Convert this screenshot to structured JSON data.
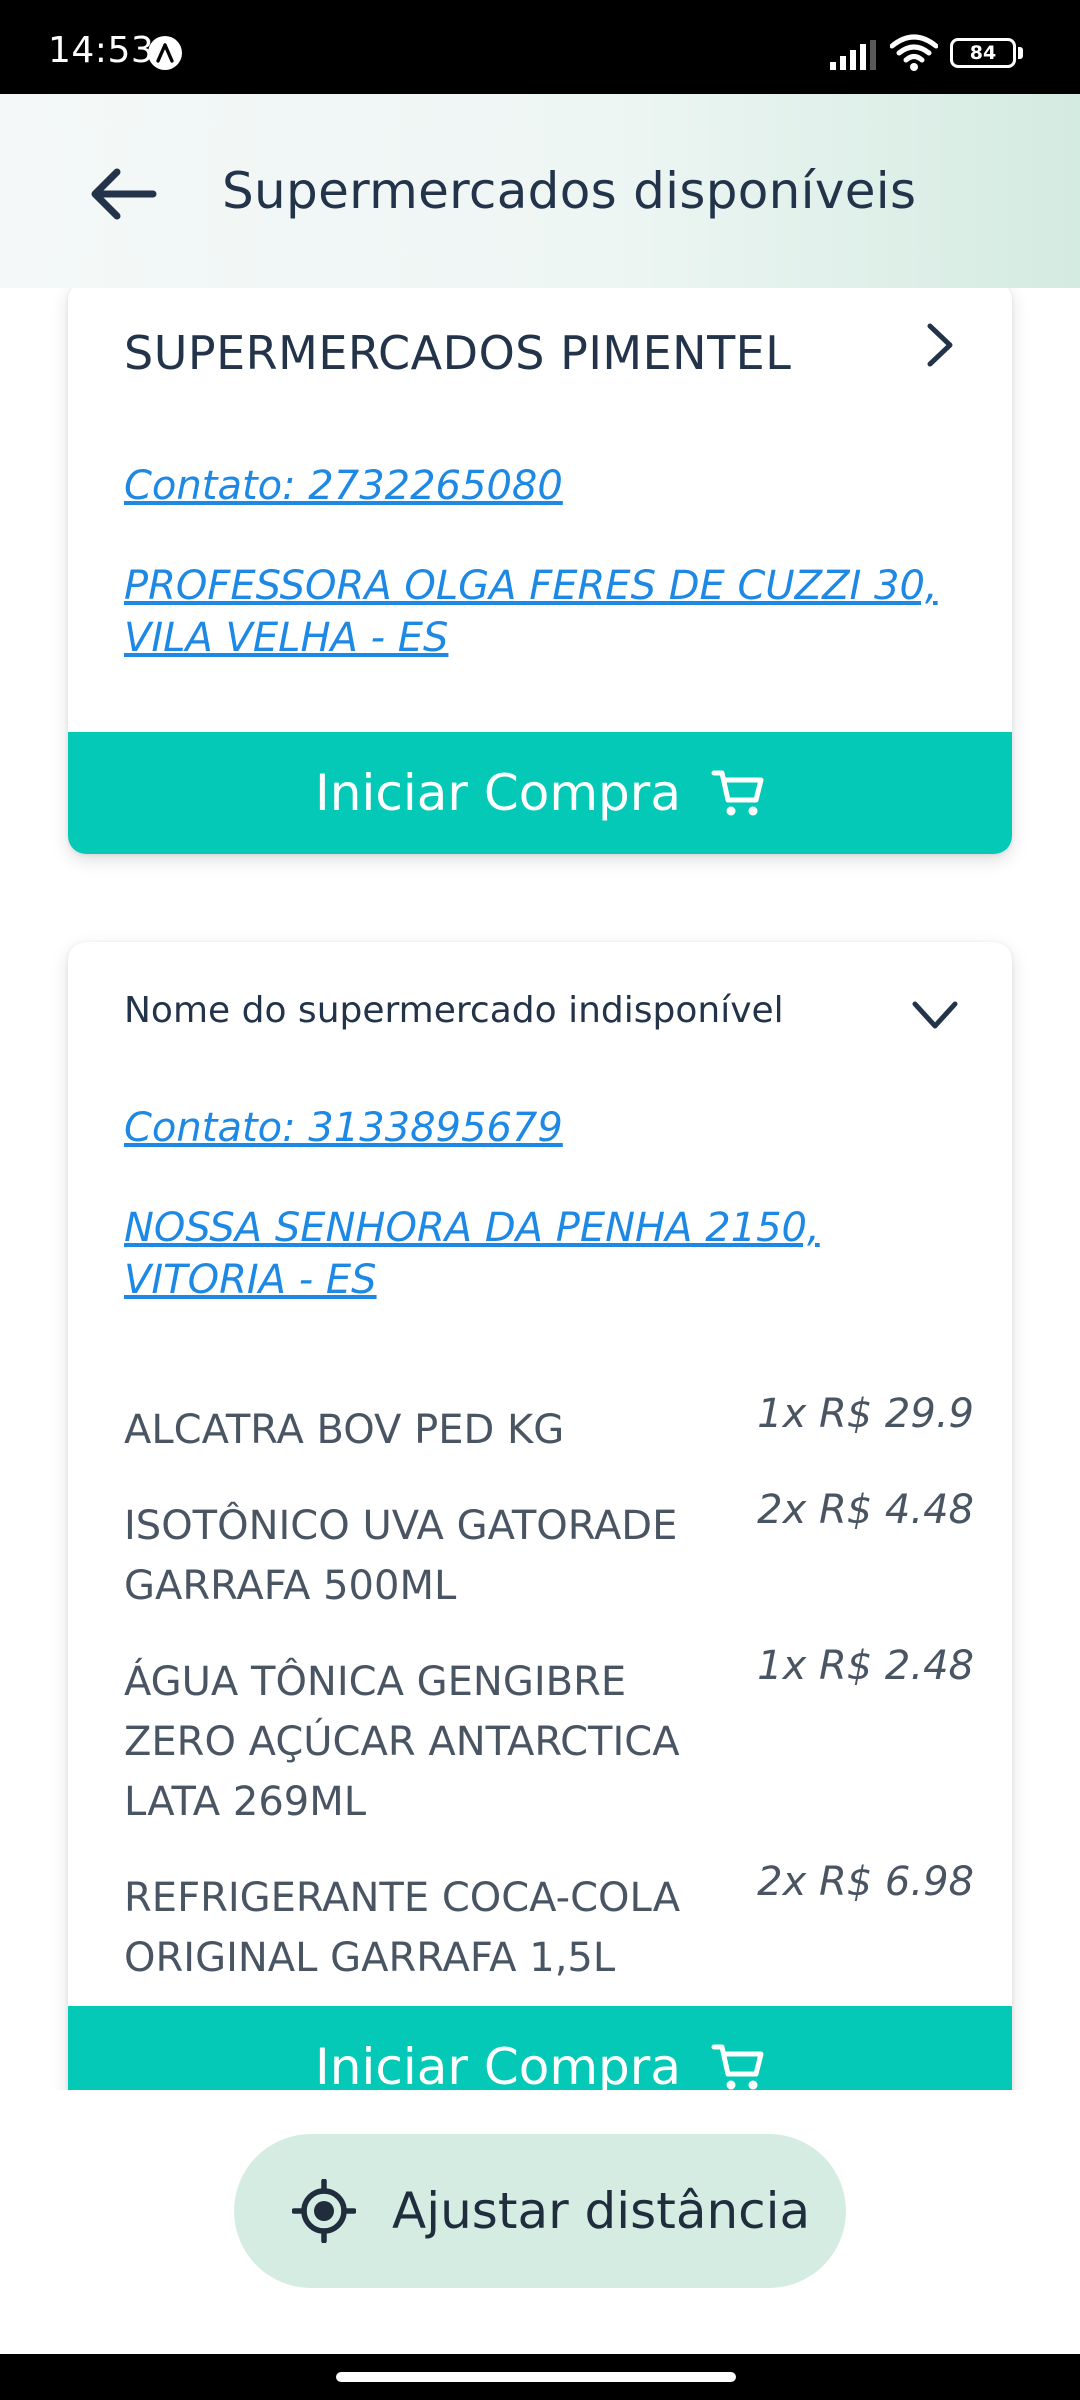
{
  "status": {
    "time": "14:53",
    "battery": "84"
  },
  "header": {
    "title": "Supermercados disponíveis"
  },
  "cards": [
    {
      "name": "SUPERMERCADOS PIMENTEL",
      "contact": "Contato: 2732265080",
      "address": "PROFESSORA OLGA FERES DE CUZZI 30, VILA VELHA - ES",
      "button": "Iniciar Compra",
      "expanded": false
    },
    {
      "name": "Nome do supermercado indisponível",
      "contact": "Contato: 3133895679",
      "address": "NOSSA SENHORA DA PENHA 2150, VITORIA - ES",
      "button": "Iniciar Compra",
      "expanded": true,
      "items": [
        {
          "name": "ALCATRA BOV PED KG",
          "price": "1x R$ 29.9"
        },
        {
          "name": "ISOTÔNICO UVA GATORADE GARRAFA 500ML",
          "price": "2x R$ 4.48"
        },
        {
          "name": "ÁGUA TÔNICA GENGIBRE ZERO AÇÚCAR ANTARCTICA LATA 269ML",
          "price": "1x R$ 2.48"
        },
        {
          "name": "REFRIGERANTE COCA-COLA ORIGINAL GARRAFA 1,5L",
          "price": "2x R$ 6.98"
        }
      ]
    }
  ],
  "adjust_button": "Ajustar distância",
  "colors": {
    "accent": "#03c9b6",
    "link": "#1e88e5",
    "pill": "#d5ece2",
    "text": "#22334a"
  },
  "icons": [
    "back-arrow-icon",
    "chevron-right-icon",
    "chevron-down-icon",
    "cart-icon",
    "gps-target-icon"
  ]
}
